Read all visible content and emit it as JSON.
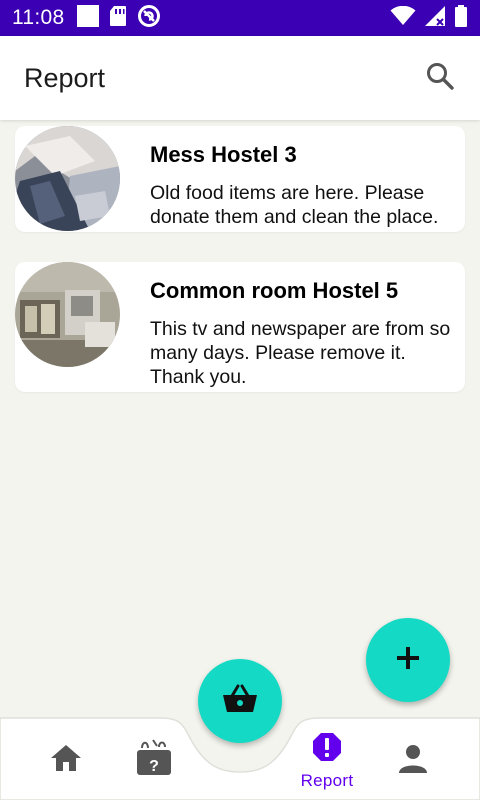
{
  "status_bar": {
    "time": "11:08",
    "left_icons": [
      "square-notification-icon",
      "sd-card-icon",
      "do-not-disturb-icon"
    ],
    "right_icons": [
      "wifi-icon",
      "signal-icon",
      "battery-icon"
    ]
  },
  "app_bar": {
    "title": "Report",
    "search_icon": "search-icon"
  },
  "reports": [
    {
      "title": "Mess Hostel 3",
      "description": "Old food items are here. Please donate them and clean the place."
    },
    {
      "title": "Common room Hostel 5",
      "description": "This tv and newspaper are from so many days. Please remove it. Thank you."
    }
  ],
  "fab": {
    "icon": "plus-icon"
  },
  "bottom_nav": {
    "center_fab_icon": "basket-icon",
    "items": [
      {
        "icon": "home-icon",
        "label": ""
      },
      {
        "icon": "quiz-bag-icon",
        "label": ""
      },
      {
        "icon": "report-alert-icon",
        "label": "Report",
        "active": true
      },
      {
        "icon": "person-icon",
        "label": ""
      }
    ]
  },
  "colors": {
    "status_bar": "#3b00b3",
    "accent": "#6200ee",
    "fab": "#14d9c4",
    "background": "#f4f4ee"
  }
}
